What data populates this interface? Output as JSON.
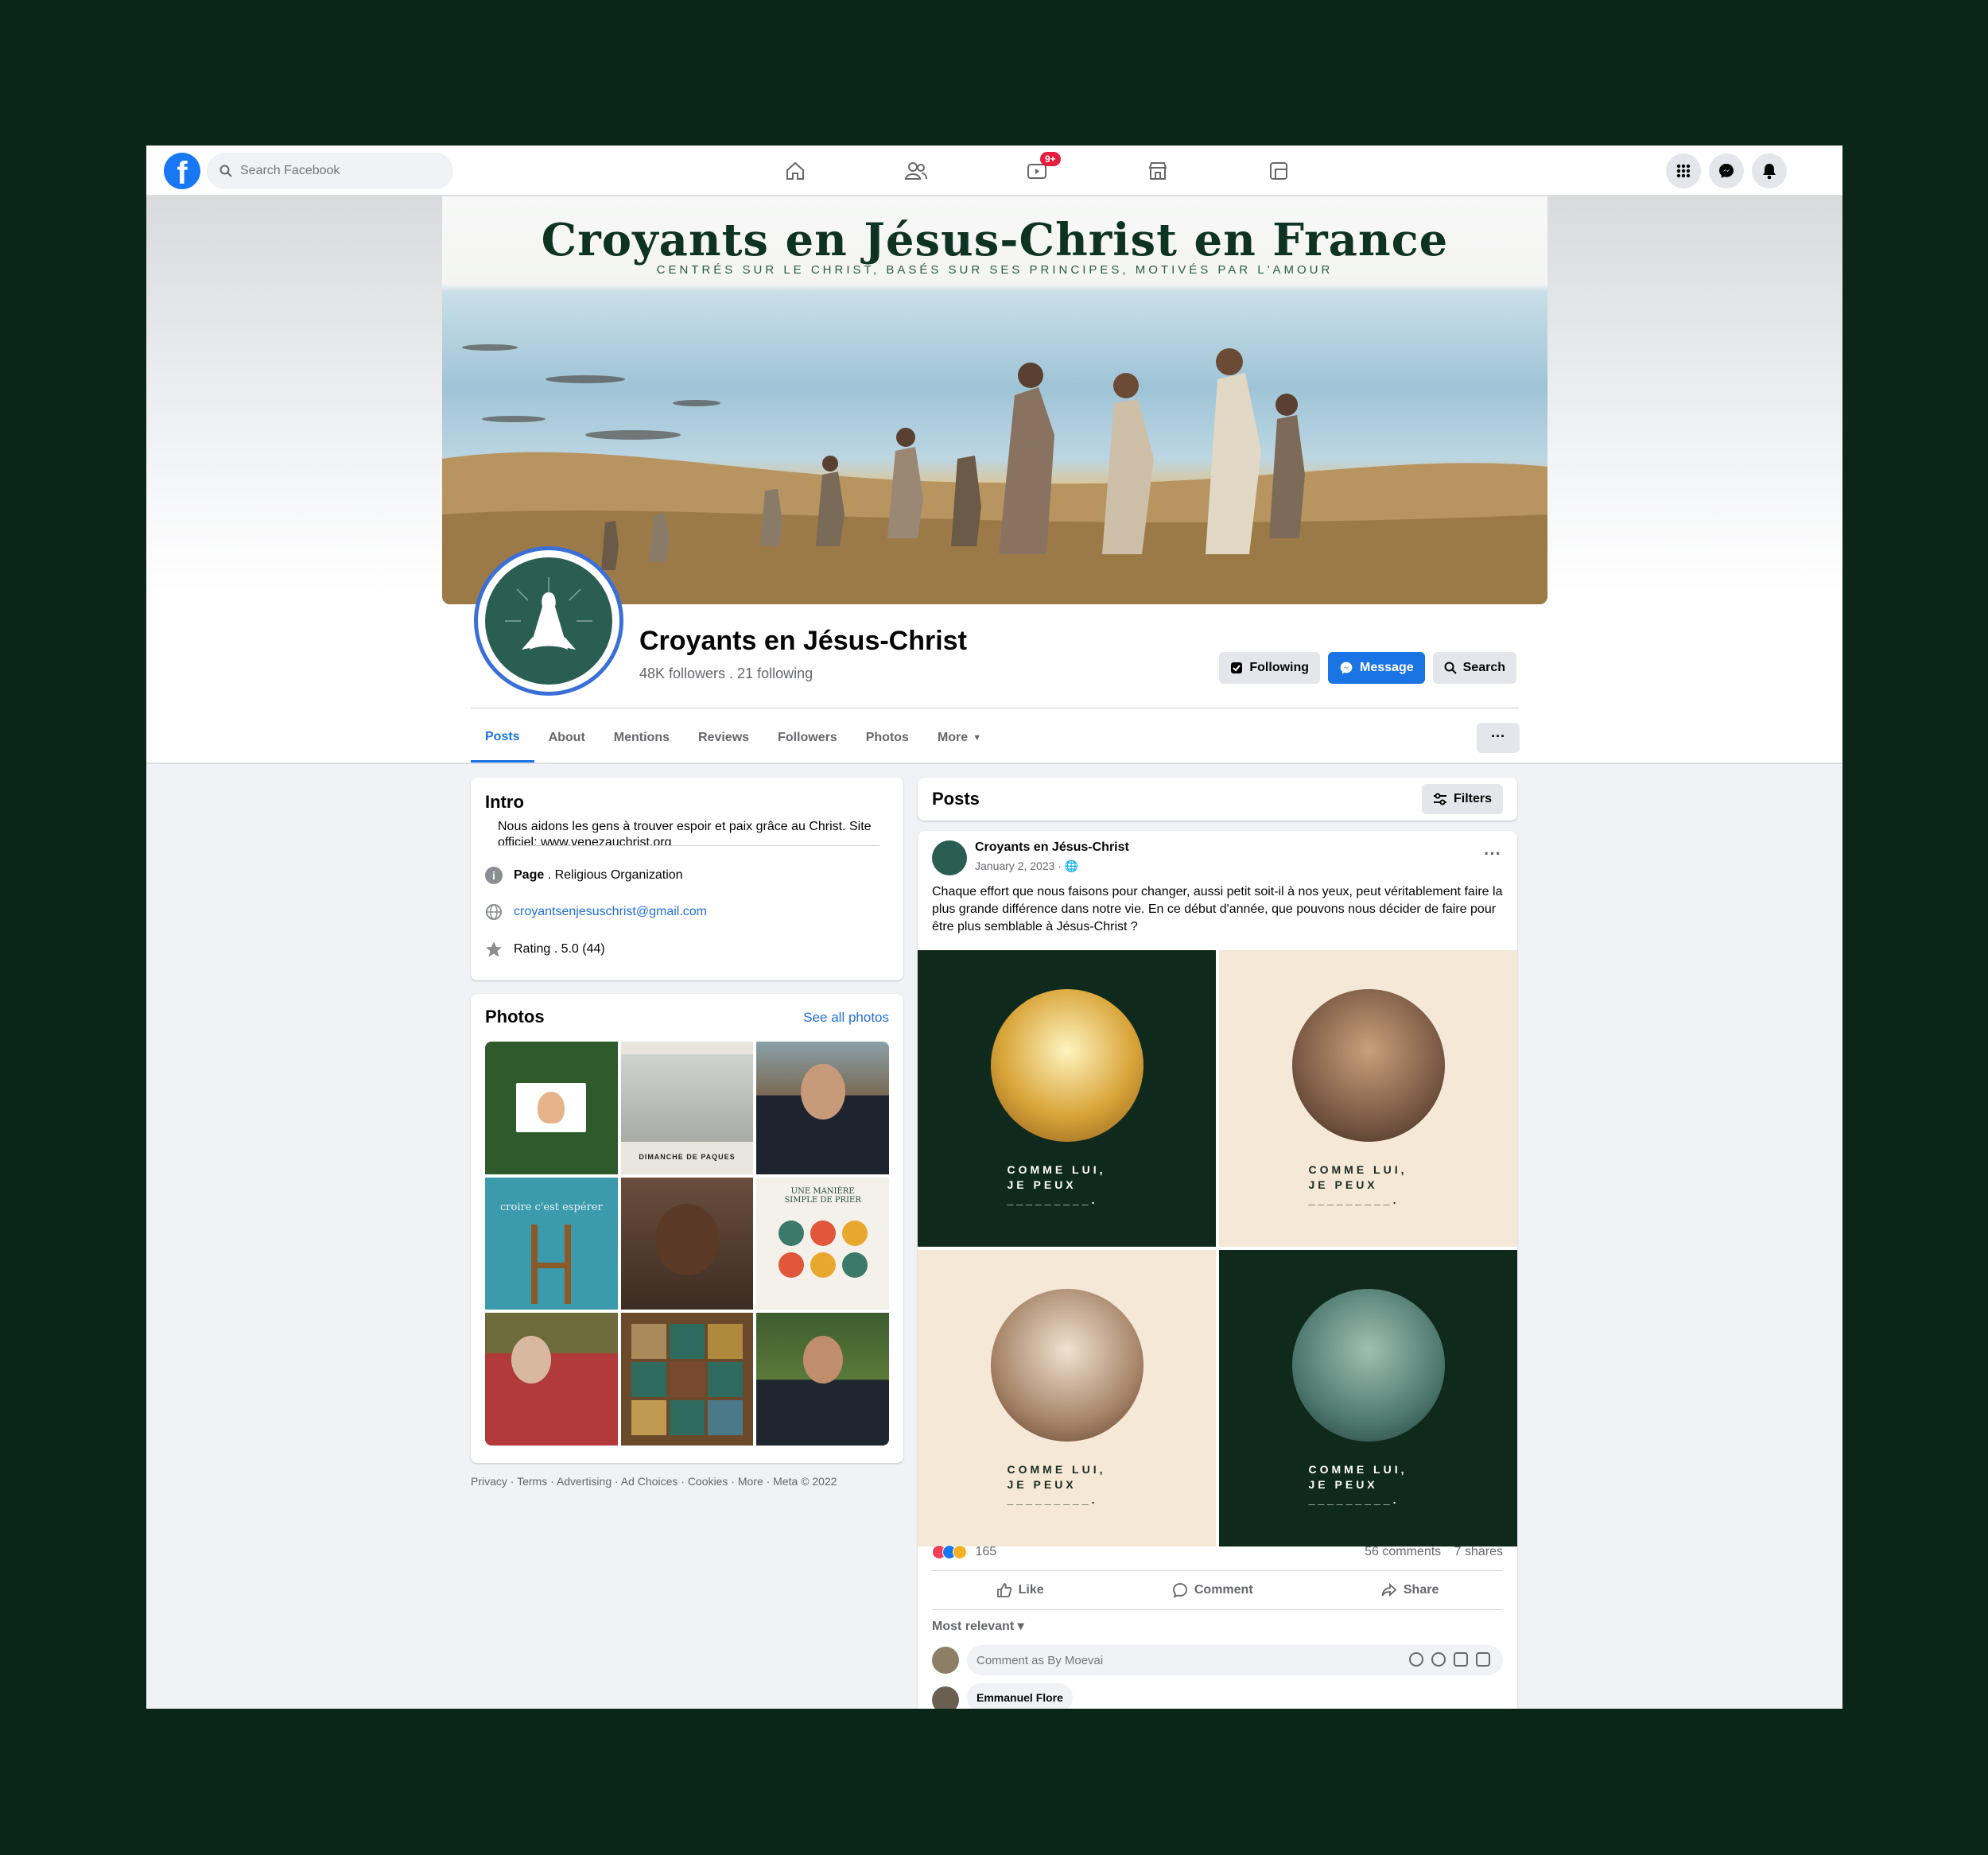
{
  "topbar": {
    "logo": "f",
    "search_placeholder": "Search Facebook",
    "notification_badge": "9+",
    "nav_icons": [
      "home-icon",
      "friends-icon",
      "watch-icon",
      "marketplace-icon",
      "gaming-icon"
    ],
    "right_icons": [
      "menu-grid-icon",
      "messenger-icon",
      "notifications-icon"
    ]
  },
  "cover": {
    "title": "Croyants en Jésus-Christ en France",
    "subtitle": "CENTRÉS SUR LE CHRIST, BASÉS SUR SES PRINCIPES, MOTIVÉS PAR L'AMOUR"
  },
  "profile": {
    "name": "Croyants en Jésus-Christ",
    "stats": "48K followers . 21 following",
    "buttons": {
      "following": "Following",
      "message": "Message",
      "search": "Search"
    }
  },
  "tabs": [
    "Posts",
    "About",
    "Mentions",
    "Reviews",
    "Followers",
    "Photos",
    "More"
  ],
  "more_button": "···",
  "intro": {
    "title": "Intro",
    "bio": "Nous aidons les gens à trouver espoir et paix grâce au Christ. Site officiel: www.venezauchrist.org",
    "page_label": "Page",
    "page_category": " . Religious Organization",
    "email": "croyantsenjesuschrist@gmail.com",
    "rating": "Rating . 5.0 (44)"
  },
  "photos": {
    "title": "Photos",
    "see_all": "See all photos",
    "captions": [
      "",
      "DIMANCHE DE PAQUES",
      "",
      "croire c'est espérer",
      "",
      "UNE MANIÈRE SIMPLE DE PRIER",
      "",
      "",
      ""
    ],
    "colors": [
      "#2f5a2c",
      "#e9e6df",
      "#7a6a55",
      "#3b9aab",
      "#5b4436",
      "#f4f1ea",
      "#8a5a48",
      "#6b4a2c",
      "#3d5c2f"
    ]
  },
  "footer": "Privacy · Terms · Advertising · Ad Choices · Cookies · More · Meta © 2022",
  "posts_header": {
    "title": "Posts",
    "filters": "Filters"
  },
  "post": {
    "author": "Croyants en Jésus-Christ",
    "date": "January 2, 2023 · ",
    "more": "···",
    "text": "Chaque effort que nous faisons pour changer, aussi petit soit-il à nos yeux, peut véritablement faire la plus grande différence dans notre vie. En ce début d'année, que pouvons nous décider de faire pour être plus semblable à Jésus-Christ ?",
    "images": [
      {
        "caption": "COMME LUI, JE PEUX _________.",
        "bg": "#0f2a1c",
        "fg": "#ffffff",
        "circle": "#d9a53a"
      },
      {
        "caption": "COMME LUI, JE PEUX _________.",
        "bg": "#f6e8d6",
        "fg": "#1b2a22",
        "circle": "#7b5a45"
      },
      {
        "caption": "COMME LUI, JE PEUX _________.",
        "bg": "#f6e8d6",
        "fg": "#1b2a22",
        "circle": "#a8866a"
      },
      {
        "caption": "COMME LUI, JE PEUX _________.",
        "bg": "#0f2a1c",
        "fg": "#ffffff",
        "circle": "#4f7a70"
      }
    ],
    "reaction_count": "165",
    "comments": "56 comments",
    "shares": "7 shares",
    "like": "Like",
    "comment": "Comment",
    "share": "Share",
    "most_relevant": "Most relevant ▾",
    "comment_placeholder": "Comment as By Moevai",
    "first_commenter": "Emmanuel Flore"
  }
}
